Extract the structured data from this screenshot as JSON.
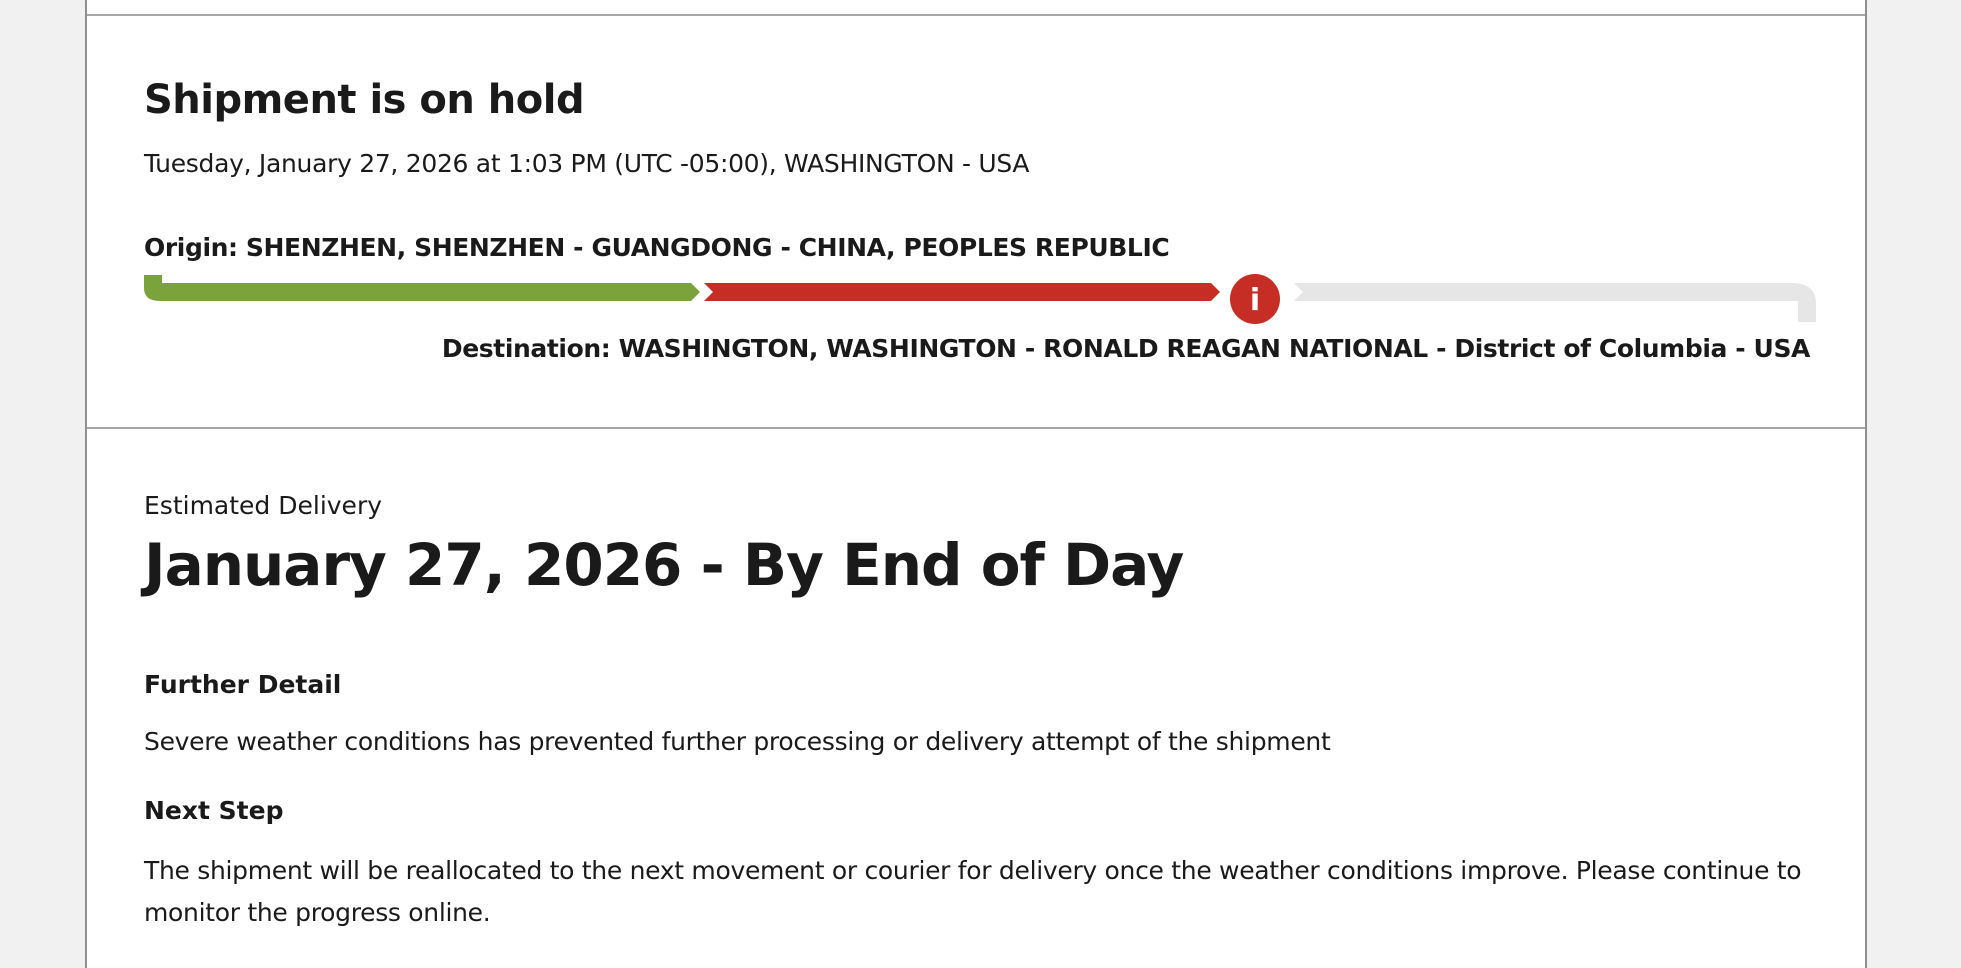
{
  "shipment_status": {
    "title": "Shipment is on hold",
    "datetime_location": "Tuesday, January 27, 2026 at 1:03 PM (UTC -05:00), WASHINGTON - USA",
    "origin": "Origin: SHENZHEN, SHENZHEN - GUANGDONG - CHINA, PEOPLES REPUBLIC",
    "destination": "Destination: WASHINGTON, WASHINGTON - RONALD REAGAN NATIONAL - District of Columbia - USA",
    "progress": {
      "completed_color": "#7aa33b",
      "on_hold_color": "#c62d24",
      "remaining_color": "#e6e6e6",
      "indicator_icon": "info-icon",
      "indicator_glyph": "i"
    }
  },
  "estimated_delivery": {
    "label": "Estimated Delivery",
    "date": "January 27, 2026 - By End of Day"
  },
  "further_detail": {
    "heading": "Further Detail",
    "text": "Severe weather conditions has prevented further processing or delivery attempt of the shipment"
  },
  "next_step": {
    "heading": "Next Step",
    "text": "The shipment will be reallocated to the next movement or courier for delivery once the weather conditions improve. Please continue to monitor the progress online."
  }
}
